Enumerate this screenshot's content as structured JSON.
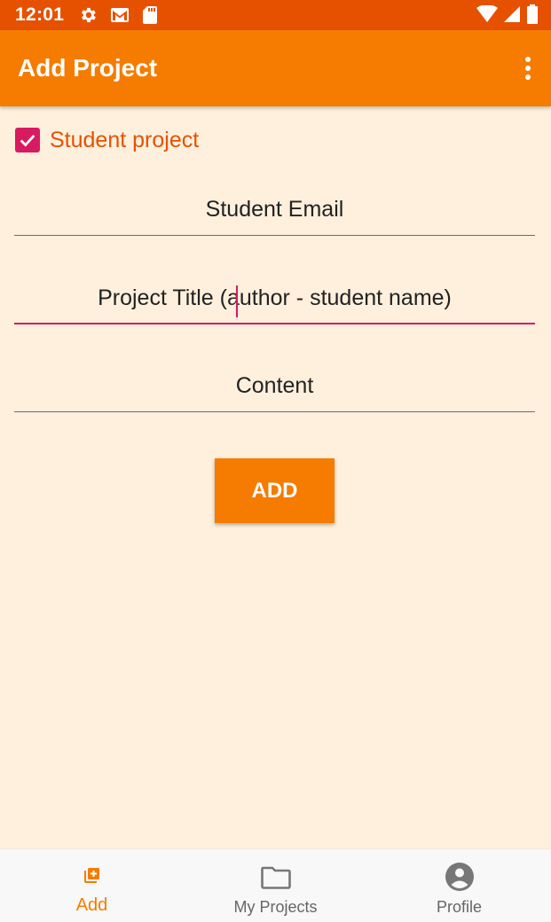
{
  "status_bar": {
    "time": "12:01",
    "left_icons": [
      "gear-icon",
      "gmail-icon",
      "sd-card-icon"
    ],
    "right_icons": [
      "wifi-icon",
      "signal-icon",
      "battery-icon"
    ]
  },
  "app_bar": {
    "title": "Add Project",
    "overflow_icon": "more-vert-icon"
  },
  "form": {
    "student_project_checkbox": {
      "label": "Student project",
      "checked": true
    },
    "student_email": {
      "placeholder": "Student Email",
      "value": ""
    },
    "project_title": {
      "placeholder": "Project Title (author - student name)",
      "value": "",
      "focused": true
    },
    "content": {
      "placeholder": "Content",
      "value": ""
    },
    "add_button_label": "ADD"
  },
  "bottom_nav": {
    "items": [
      {
        "label": "Add",
        "icon": "add-box-icon",
        "active": true
      },
      {
        "label": "My Projects",
        "icon": "folder-icon",
        "active": false
      },
      {
        "label": "Profile",
        "icon": "account-circle-icon",
        "active": false
      }
    ]
  },
  "colors": {
    "status_bar": "#e65100",
    "app_bar": "#f57c00",
    "background": "#fef0dd",
    "accent": "#d81b60",
    "active_nav": "#f57c00"
  }
}
